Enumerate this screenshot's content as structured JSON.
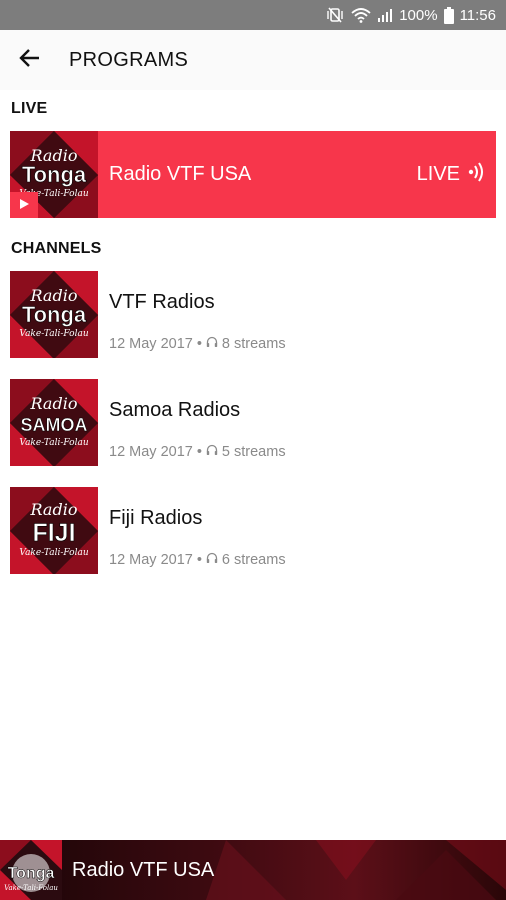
{
  "status_bar": {
    "battery": "100%",
    "time": "11:56",
    "icons": [
      "mute-vibrate-icon",
      "wifi-icon",
      "signal-icon",
      "battery-icon"
    ]
  },
  "app_bar": {
    "title": "PROGRAMS",
    "back_icon": "arrow-left-icon"
  },
  "live_section": {
    "label": "LIVE",
    "item": {
      "title": "Radio VTF USA",
      "badge": "LIVE",
      "thumb": {
        "line1": "Radio",
        "line2": "Tonga",
        "line3": "Vake-Tali-Folau"
      }
    }
  },
  "channels_section": {
    "label": "CHANNELS",
    "items": [
      {
        "title": "VTF Radios",
        "date": "12 May 2017",
        "streams": "8 streams",
        "thumb": {
          "line1": "Radio",
          "line2": "Tonga",
          "line3": "Vake-Tali-Folau"
        }
      },
      {
        "title": "Samoa Radios",
        "date": "12 May 2017",
        "streams": "5 streams",
        "thumb": {
          "line1": "Radio",
          "line2": "SAMOA",
          "line3": "Vake-Tali-Folau"
        }
      },
      {
        "title": "Fiji Radios",
        "date": "12 May 2017",
        "streams": "6 streams",
        "thumb": {
          "line1": "Radio",
          "line2": "FIJI",
          "line3": "Vake-Tali-Folau"
        }
      }
    ]
  },
  "player": {
    "title": "Radio VTF USA",
    "thumb": {
      "line2": "Tonga",
      "line3": "Vake-Tali-Folau"
    }
  },
  "colors": {
    "accent": "#f7364b",
    "status_bar": "#7d7d7d",
    "app_bar": "#fafafa",
    "meta_text": "#8a8a8a",
    "thumb_dark": "#2b0b10",
    "thumb_red": "#c4142a"
  }
}
